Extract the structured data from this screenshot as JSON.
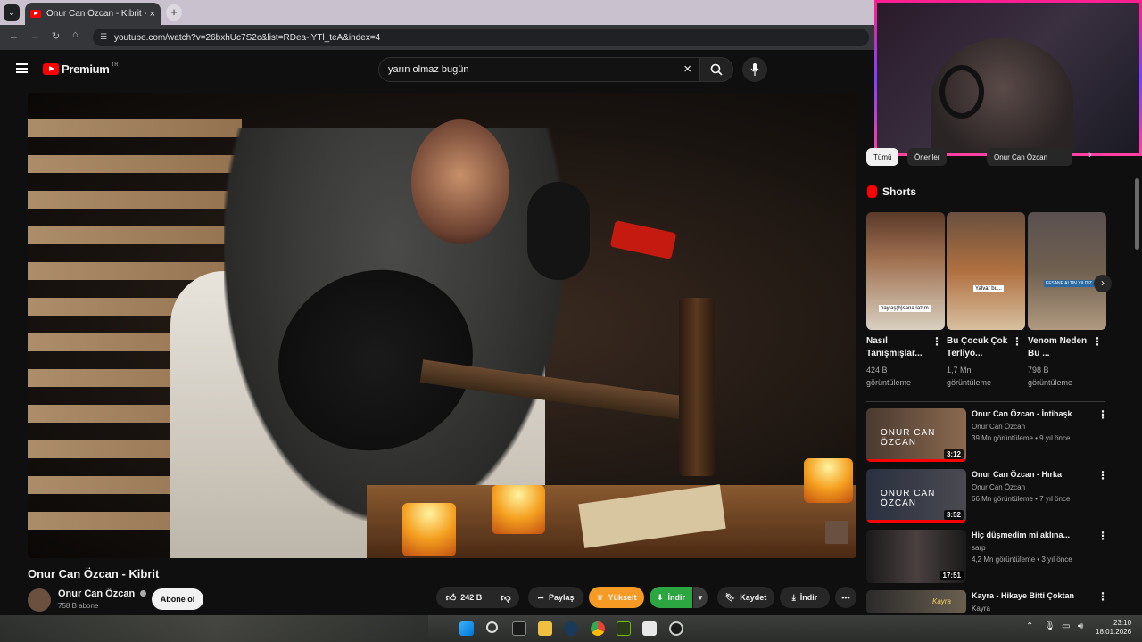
{
  "browser": {
    "tab_title": "Onur Can Özcan - Kibrit - Y",
    "url": "youtube.com/watch?v=26bxhUc7S2c&list=RDea-iYTl_teA&index=4"
  },
  "youtube": {
    "logo_text": "Premium",
    "region": "TR",
    "search_value": "yarın olmaz bugün"
  },
  "video": {
    "title": "Onur Can Özcan - Kibrit",
    "channel": "Onur Can Özcan",
    "subscribers": "758 B abone",
    "subscribe_label": "Abone ol",
    "likes": "242 B",
    "share_label": "Paylaş",
    "upgrade_label": "Yükselt",
    "download_label": "İndir",
    "save_label": "Kaydet",
    "download2_label": "İndir"
  },
  "chips": [
    "Tümü",
    "Öneriler",
    "Onur Can Özcan"
  ],
  "shorts": {
    "heading": "Shorts",
    "items": [
      {
        "title": "Nasıl Tanışmışlar...",
        "views": "424 B görüntüleme",
        "caption": "paylaş(b)sana lazım"
      },
      {
        "title": "Bu Çocuk Çok Terliyo...",
        "views": "1,7 Mn görüntüleme",
        "caption": "Yalvar bu..."
      },
      {
        "title": "Venom Neden Bu ...",
        "views": "798 B görüntüleme",
        "caption": "EFSANE ALTIN YILDIZ"
      }
    ]
  },
  "related": [
    {
      "title": "Onur Can Özcan - İntihaşk",
      "channel": "Onur Can Özcan",
      "meta": "39 Mn görüntüleme • 9 yıl önce",
      "duration": "3:12",
      "overlay": "ONUR CAN ÖZCAN"
    },
    {
      "title": "Onur Can Özcan - Hırka",
      "channel": "Onur Can Özcan",
      "meta": "66 Mn görüntüleme • 7 yıl önce",
      "duration": "3:52",
      "overlay": "ONUR CAN ÖZCAN"
    },
    {
      "title": "Hiç düşmedim mi aklına...",
      "channel": "sarp",
      "meta": "4,2 Mn görüntüleme • 3 yıl önce",
      "duration": "17:51",
      "overlay": ""
    },
    {
      "title": "Kayra - Hikaye Bitti Çoktan",
      "channel": "Kayra",
      "meta": "",
      "duration": "",
      "overlay": "Kayra"
    }
  ],
  "clock": {
    "time": "23:10",
    "date": "18.01.2026"
  },
  "colors": {
    "accent_red": "#ff0000",
    "upgrade_orange": "#f59a23",
    "download_green": "#2ba640"
  }
}
